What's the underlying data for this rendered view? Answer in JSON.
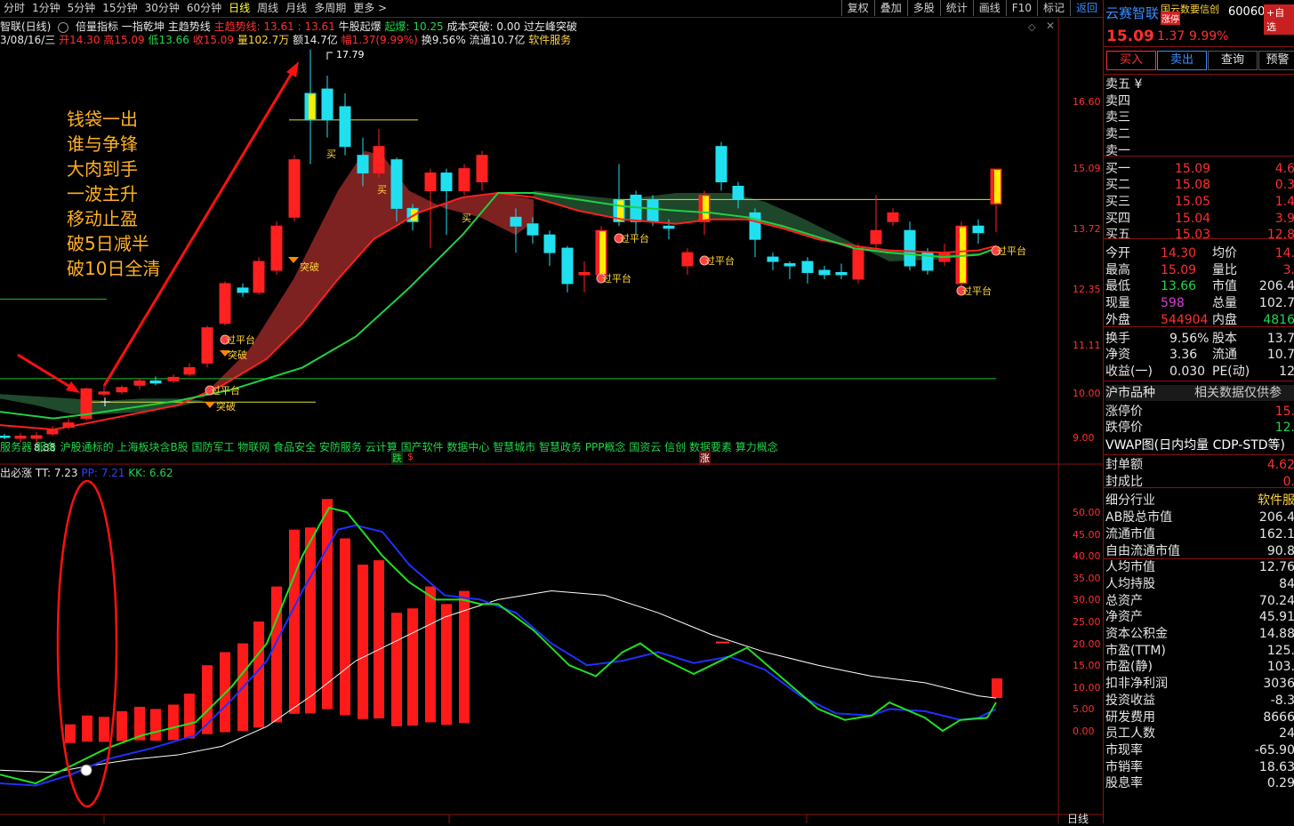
{
  "toolbar": {
    "periods": [
      "分时",
      "1分钟",
      "5分钟",
      "15分钟",
      "30分钟",
      "60分钟",
      "日线",
      "周线",
      "月线",
      "多周期",
      "更多 >"
    ],
    "active_period": "日线",
    "tools": [
      "复权",
      "叠加",
      "多股",
      "统计",
      "画线",
      "F10",
      "标记",
      "返回"
    ]
  },
  "info_line1": {
    "title": "智联(日线)",
    "items": [
      "倍量指标",
      "一指乾坤",
      "主趋势线"
    ],
    "main_trend": "主趋势线: 13.61 : 13.61",
    "niu": "牛股起爆",
    "qibao": "起爆: 10.25",
    "chengben": "成本突破: 0.00",
    "tupo": "过左峰突破"
  },
  "info_line2": {
    "date": "3/08/16/三",
    "open": "开14.30",
    "high": "高15.09",
    "low": "低13.66",
    "close": "收15.09",
    "vol": "量102.7万",
    "amount": "额14.7亿",
    "pct": "幅1.37(9.99%)",
    "turnover": "换9.56%",
    "float": "流通10.7亿",
    "industry": "软件服务"
  },
  "chart_annotations": {
    "note_lines": [
      "钱袋一出",
      "谁与争锋",
      "大肉到手",
      "一波主升",
      "移动止盈",
      "破5日减半",
      "破10日全清"
    ],
    "peak_label": "17.79",
    "low_label": "8.88",
    "buy_label": "买",
    "signal_label": "过平台",
    "break_label": "突破"
  },
  "concepts_line": "服务器 服务 沪股通标的 上海板块含B股 国防军工 物联网 食品安全 安防服务 云计算 国产软件 数据中心 智慧城市 智慧政务 PPP概念 国资云 信创 数据要素 算力概念",
  "markers": {
    "die": "跌",
    "dollar": "$",
    "zhang": "涨"
  },
  "main_axis": [
    "16.60",
    "15.09",
    "13.72",
    "12.35",
    "11.11",
    "10.00",
    "9.00"
  ],
  "indicator": {
    "name": "出必涨",
    "tt": "TT: 7.23",
    "pp": "PP: 7.21",
    "kk": "KK: 6.62",
    "axis": [
      "50.00",
      "45.00",
      "40.00",
      "35.00",
      "30.00",
      "25.00",
      "20.00",
      "15.00",
      "10.00",
      "5.00",
      "0.00"
    ]
  },
  "footer": {
    "right_label": "日线"
  },
  "colors": {
    "up": "#ff2020",
    "down": "#20e0f0",
    "ma_red": "#ff2020",
    "ma_green": "#20d040",
    "band_red": "#8b2525",
    "band_green": "#1f4a2c"
  },
  "right_panel": {
    "name": "云赛智联",
    "code": "60060",
    "badge_concept": "国云数要信创",
    "badge_limit": "涨停",
    "add_btn": "+自选",
    "price": "15.09",
    "change": "1.37",
    "pct": "9.99%",
    "buttons": [
      "买入",
      "卖出",
      "查询",
      "预警"
    ],
    "sells": [
      {
        "label": "卖五 ¥",
        "price": "",
        "vol": ""
      },
      {
        "label": "卖四",
        "price": "",
        "vol": ""
      },
      {
        "label": "卖三",
        "price": "",
        "vol": ""
      },
      {
        "label": "卖二",
        "price": "",
        "vol": ""
      },
      {
        "label": "卖一",
        "price": "",
        "vol": ""
      }
    ],
    "buys": [
      {
        "label": "买一",
        "price": "15.09",
        "vol": "4.6"
      },
      {
        "label": "买二",
        "price": "15.08",
        "vol": "0.3"
      },
      {
        "label": "买三",
        "price": "15.05",
        "vol": "1.4"
      },
      {
        "label": "买四",
        "price": "15.04",
        "vol": "3.9"
      },
      {
        "label": "买五",
        "price": "15.03",
        "vol": "12.8"
      }
    ],
    "stats1": [
      {
        "l1": "今开",
        "v1": "14.30",
        "l2": "均价",
        "v2": "14."
      },
      {
        "l1": "最高",
        "v1": "15.09",
        "l2": "量比",
        "v2": "3."
      },
      {
        "l1": "最低",
        "v1": "13.66",
        "l2": "市值",
        "v2": "206.4"
      },
      {
        "l1": "现量",
        "v1": "598",
        "l2": "总量",
        "v2": "102.7"
      },
      {
        "l1": "外盘",
        "v1": "544904",
        "l2": "内盘",
        "v2": "4816"
      }
    ],
    "stats2": [
      {
        "l1": "换手",
        "v1": "9.56%",
        "l2": "股本",
        "v2": "13.7"
      },
      {
        "l1": "净资",
        "v1": "3.36",
        "l2": "流通",
        "v2": "10.7"
      },
      {
        "l1": "收益(一)",
        "v1": "0.030",
        "l2": "PE(动)",
        "v2": "12"
      }
    ],
    "section_title": "沪市品种",
    "section_note": "相关数据仅供参",
    "limit_rows": [
      {
        "label": "涨停价",
        "value": "15."
      },
      {
        "label": "跌停价",
        "value": "12."
      }
    ],
    "vwap": "VWAP图(日内均量 CDP-STD等)",
    "seal_rows": [
      {
        "label": "封单额",
        "value": "4.62"
      },
      {
        "label": "封成比",
        "value": "0."
      }
    ],
    "fin_rows": [
      {
        "label": "细分行业",
        "value": "软件服"
      },
      {
        "label": "AB股总市值",
        "value": "206.4"
      },
      {
        "label": "流通市值",
        "value": "162.1"
      },
      {
        "label": "自由流通市值",
        "value": "90.8"
      },
      {
        "label": "人均市值",
        "value": "12.76"
      },
      {
        "label": "人均持股",
        "value": "84"
      },
      {
        "label": "总资产",
        "value": "70.24"
      },
      {
        "label": "净资产",
        "value": "45.91"
      },
      {
        "label": "资本公积金",
        "value": "14.88"
      },
      {
        "label": "市盈(TTM)",
        "value": "125."
      },
      {
        "label": "市盈(静)",
        "value": "103."
      },
      {
        "label": "扣非净利润",
        "value": "3036"
      },
      {
        "label": "投资收益",
        "value": "-8.3"
      },
      {
        "label": "研发费用",
        "value": "8666"
      },
      {
        "label": "员工人数",
        "value": "24"
      },
      {
        "label": "市现率",
        "value": "-65.90"
      },
      {
        "label": "市销率",
        "value": "18.63"
      },
      {
        "label": "股息率",
        "value": "0.29"
      }
    ]
  }
}
